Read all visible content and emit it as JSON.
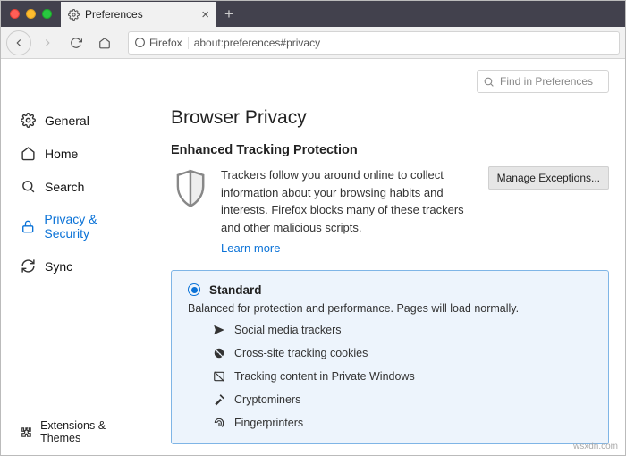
{
  "tab": {
    "title": "Preferences"
  },
  "urlbar": {
    "identity": "Firefox",
    "url": "about:preferences#privacy"
  },
  "search": {
    "placeholder": "Find in Preferences"
  },
  "sidebar": {
    "items": [
      {
        "label": "General"
      },
      {
        "label": "Home"
      },
      {
        "label": "Search"
      },
      {
        "label": "Privacy & Security"
      },
      {
        "label": "Sync"
      }
    ],
    "bottom": {
      "label": "Extensions & Themes"
    }
  },
  "page": {
    "title": "Browser Privacy",
    "section_title": "Enhanced Tracking Protection",
    "etp_desc": "Trackers follow you around online to collect information about your browsing habits and interests. Firefox blocks many of these trackers and other malicious scripts.",
    "learn_more": "Learn more",
    "manage_exceptions": "Manage Exceptions...",
    "standard": {
      "title": "Standard",
      "desc": "Balanced for protection and performance. Pages will load normally.",
      "items": [
        "Social media trackers",
        "Cross-site tracking cookies",
        "Tracking content in Private Windows",
        "Cryptominers",
        "Fingerprinters"
      ]
    }
  },
  "watermark": "wsxdn.com"
}
